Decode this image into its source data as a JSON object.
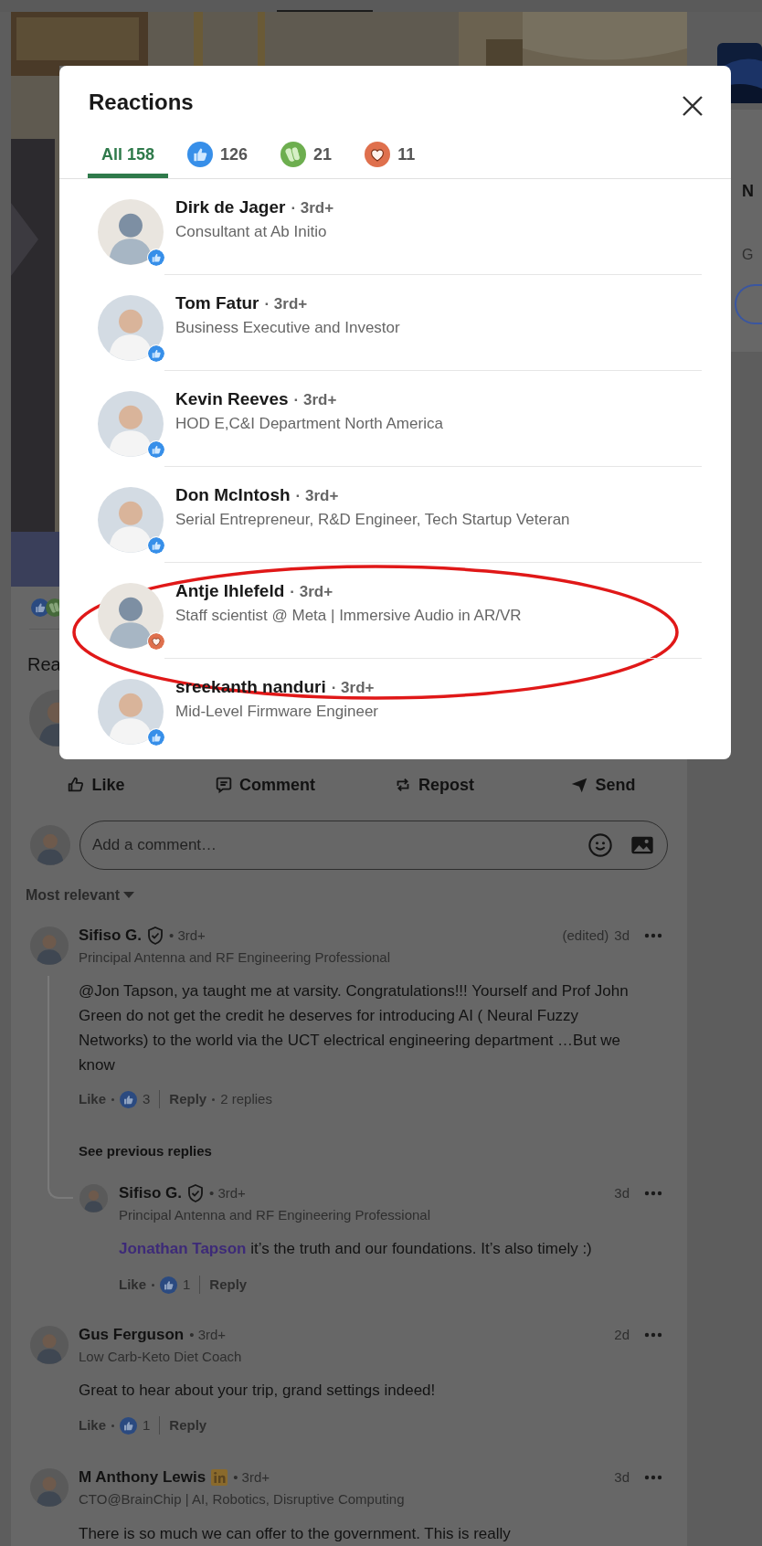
{
  "modal": {
    "title": "Reactions",
    "tabs": [
      {
        "kind": "all",
        "label": "All 158",
        "selected": true
      },
      {
        "kind": "like",
        "count": "126",
        "selected": false
      },
      {
        "kind": "celebrate",
        "count": "21",
        "selected": false
      },
      {
        "kind": "love",
        "count": "11",
        "selected": false
      }
    ],
    "reactors": [
      {
        "name": "Dirk de Jager",
        "degree": "· 3rd+",
        "headline": "Consultant at Ab Initio",
        "kind": "like",
        "avatar": {
          "kind": "placeholder"
        },
        "circled": false
      },
      {
        "name": "Tom Fatur",
        "degree": "· 3rd+",
        "headline": "Business Executive and Investor",
        "kind": "like",
        "circled": false
      },
      {
        "name": "Kevin Reeves",
        "degree": "· 3rd+",
        "headline": "HOD E,C&I Department North America",
        "kind": "like",
        "circled": false
      },
      {
        "name": "Don McIntosh",
        "degree": "· 3rd+",
        "headline": "Serial Entrepreneur, R&D Engineer, Tech Startup Veteran",
        "kind": "like",
        "circled": false
      },
      {
        "name": "Antje Ihlefeld",
        "degree": "· 3rd+",
        "headline": "Staff scientist @ Meta | Immersive Audio in AR/VR",
        "kind": "love",
        "avatar": {
          "kind": "placeholder"
        },
        "circled": true
      },
      {
        "name": "sreekanth nanduri",
        "degree": "· 3rd+",
        "headline": "Mid-Level Firmware Engineer",
        "kind": "like",
        "circled": false
      }
    ]
  },
  "post": {
    "section_heading": "Rea",
    "actions": [
      {
        "kind": "like",
        "label": "Like"
      },
      {
        "kind": "comment",
        "label": "Comment"
      },
      {
        "kind": "repost",
        "label": "Repost"
      },
      {
        "kind": "send",
        "label": "Send"
      }
    ],
    "comment_box": {
      "placeholder": "Add a comment…"
    },
    "sort": "Most relevant",
    "comments": [
      {
        "name": "Sifiso G.",
        "badge": {
          "kind": "verified"
        },
        "degree": "• 3rd+",
        "headline": "Principal Antenna and RF Engineering Professional",
        "edited": "(edited)",
        "time": "3d",
        "body": "@Jon Tapson, ya taught me at varsity. Congratulations!!! Yourself and Prof John Green do not get the credit he deserves for introducing AI ( Neural Fuzzy Networks) to the world via the UCT electrical engineering department …But we know",
        "like": "Like",
        "likes": "3",
        "reply": "Reply",
        "replies": "2 replies",
        "see_previous": "See previous replies",
        "thread": [
          {
            "name": "Sifiso G.",
            "badge": {
              "kind": "verified"
            },
            "degree": "• 3rd+",
            "headline": "Principal Antenna and RF Engineering Professional",
            "time": "3d",
            "mention": "Jonathan Tapson",
            "body": " it’s the truth and our foundations. It’s also timely :)",
            "like": "Like",
            "likes": "1",
            "reply": "Reply"
          }
        ]
      },
      {
        "name": "Gus Ferguson",
        "degree": "• 3rd+",
        "headline": "Low Carb-Keto Diet Coach",
        "time": "2d",
        "body": "Great to hear about your trip, grand settings indeed!",
        "like": "Like",
        "likes": "1",
        "reply": "Reply"
      },
      {
        "name": "M Anthony Lewis",
        "badge": {
          "kind": "linkedin"
        },
        "degree": "• 3rd+",
        "headline": "CTO@BrainChip | AI, Robotics, Disruptive Computing",
        "time": "3d",
        "body": "There is so much we can offer to the government. This is really"
      }
    ]
  },
  "sidebar": {
    "letters": [
      "N",
      "G"
    ]
  }
}
